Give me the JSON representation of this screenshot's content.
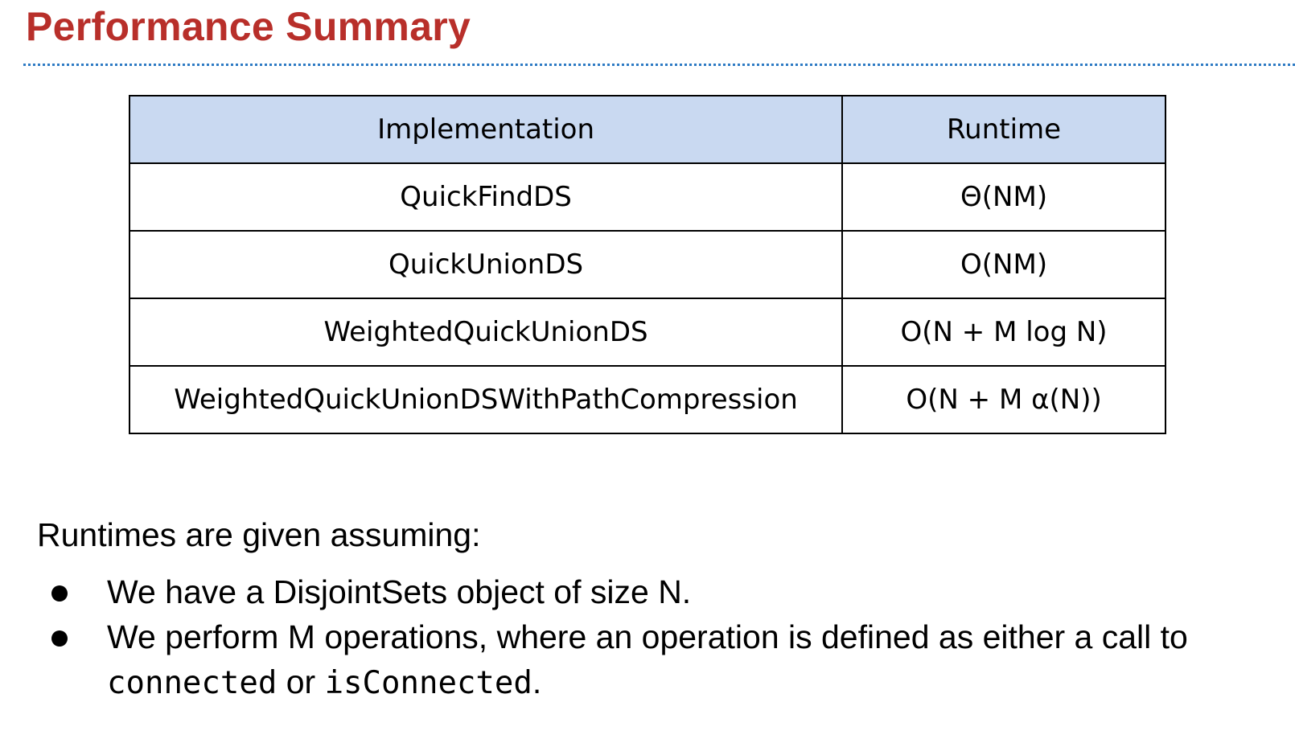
{
  "title": "Performance Summary",
  "table": {
    "headers": [
      "Implementation",
      "Runtime"
    ],
    "rows": [
      [
        "QuickFindDS",
        "Θ(NM)"
      ],
      [
        "QuickUnionDS",
        "O(NM)"
      ],
      [
        "WeightedQuickUnionDS",
        "O(N + M log N)"
      ],
      [
        "WeightedQuickUnionDSWithPathCompression",
        "O(N + M α(N))"
      ]
    ]
  },
  "note": "Runtimes are given assuming:",
  "bullets": {
    "first": "We have a DisjointSets object of size N.",
    "second_line1": "We perform M operations, where an operation is defined as either a call to",
    "second_code1": "connected",
    "second_or": " or ",
    "second_code2": "isConnected",
    "second_end": "."
  },
  "colors": {
    "title": "#b82f2a",
    "rule": "#2e7bc4",
    "header_fill": "#c9d9f1"
  }
}
